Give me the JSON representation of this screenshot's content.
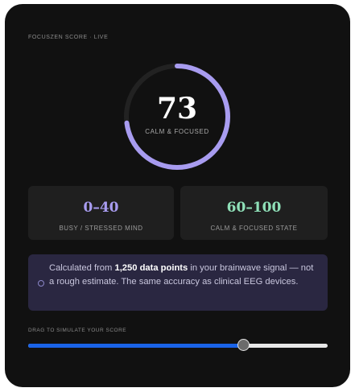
{
  "header": {
    "label": "FOCUSZEN SCORE · LIVE"
  },
  "gauge": {
    "score": "73",
    "state": "CALM & FOCUSED",
    "fill_fraction": 0.73,
    "color": "#a89cf0",
    "track_color": "#222222"
  },
  "ranges": [
    {
      "value": "0–40",
      "label": "BUSY / STRESSED MIND",
      "color": "#a89cf0"
    },
    {
      "value": "60–100",
      "label": "CALM & FOCUSED STATE",
      "color": "#8fe0b8"
    }
  ],
  "info": {
    "icon": "info-circle-icon",
    "prefix": "Calculated from ",
    "highlight": "1,250 data points",
    "suffix": " in your brainwave signal — not a rough estimate. The same accuracy as clinical EEG devices."
  },
  "slider": {
    "label": "DRAG TO SIMULATE YOUR SCORE",
    "value_fraction": 0.72,
    "fill_color": "#1a63e8"
  }
}
